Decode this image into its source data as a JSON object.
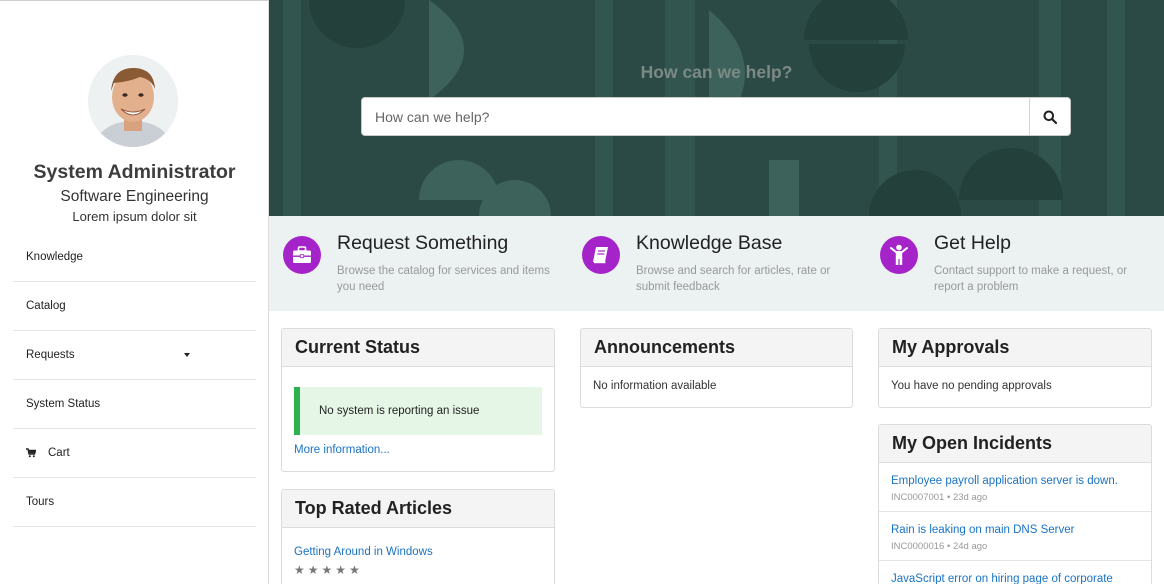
{
  "profile": {
    "name": "System Administrator",
    "department": "Software Engineering",
    "subtitle": "Lorem ipsum dolor sit"
  },
  "nav": {
    "items": [
      {
        "label": "Knowledge"
      },
      {
        "label": "Catalog"
      },
      {
        "label": "Requests",
        "has_dropdown": true
      },
      {
        "label": "System Status"
      },
      {
        "label": "Cart",
        "icon": "cart-icon"
      },
      {
        "label": "Tours"
      }
    ]
  },
  "hero": {
    "title": "How can we help?",
    "search_placeholder": "How can we help?",
    "search_icon": "search-icon",
    "bg_color": "#2b4a45"
  },
  "quick_links": [
    {
      "title": "Request Something",
      "description": "Browse the catalog for services and items you need",
      "icon": "briefcase-icon"
    },
    {
      "title": "Knowledge Base",
      "description": "Browse and search for articles, rate or submit feedback",
      "icon": "book-icon"
    },
    {
      "title": "Get Help",
      "description": "Contact support to make a request, or report a problem",
      "icon": "person-icon"
    }
  ],
  "accent_color": "#a524c9",
  "current_status": {
    "title": "Current Status",
    "message": "No system is reporting an issue",
    "more_link": "More information...",
    "status_color": "#2bb24c"
  },
  "top_rated": {
    "title": "Top Rated Articles",
    "articles": [
      {
        "title": "Getting Around in Windows",
        "rating": 0,
        "max_rating": 5
      }
    ]
  },
  "announcements": {
    "title": "Announcements",
    "message": "No information available"
  },
  "approvals": {
    "title": "My Approvals",
    "message": "You have no pending approvals"
  },
  "incidents": {
    "title": "My Open Incidents",
    "items": [
      {
        "title": "Employee payroll application server is down.",
        "number": "INC0007001",
        "age": "23d ago"
      },
      {
        "title": "Rain is leaking on main DNS Server",
        "number": "INC0000016",
        "age": "24d ago"
      },
      {
        "title": "JavaScript error on hiring page of corporate",
        "number": "",
        "age": ""
      }
    ]
  }
}
